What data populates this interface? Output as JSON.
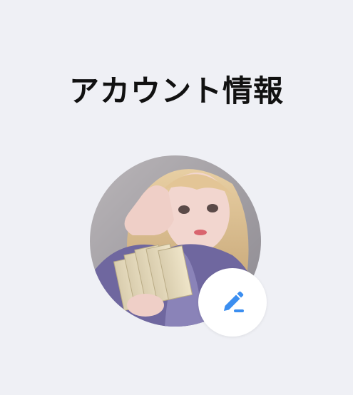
{
  "header": {
    "title": "アカウント情報"
  },
  "profile": {
    "avatar_icon": "profile-photo",
    "edit_icon": "pencil-edit-icon"
  },
  "colors": {
    "background": "#eff0f5",
    "accent": "#3b8ef0",
    "title": "#111111"
  }
}
